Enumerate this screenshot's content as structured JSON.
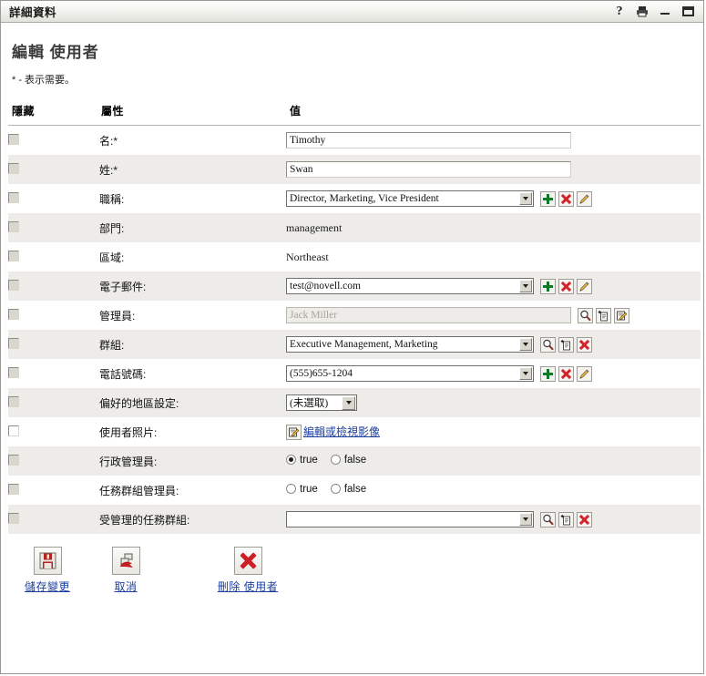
{
  "window": {
    "title": "詳細資料",
    "buttons": {
      "help": "?",
      "print": "print-icon",
      "minimize": "_",
      "maximize": "□"
    }
  },
  "page": {
    "heading": "編輯 使用者",
    "required_note": "* - 表示需要。"
  },
  "table": {
    "headers": {
      "hide": "隱藏",
      "attribute": "屬性",
      "value": "值"
    },
    "rows": [
      {
        "attribute": "名:*",
        "type": "text",
        "value": "Timothy",
        "checkbox_enabled": false,
        "actions": []
      },
      {
        "attribute": "姓:*",
        "type": "text",
        "value": "Swan",
        "checkbox_enabled": false,
        "actions": []
      },
      {
        "attribute": "職稱:",
        "type": "combo",
        "value": "Director, Marketing, Vice President",
        "checkbox_enabled": false,
        "actions": [
          "add-icon",
          "delete-icon",
          "edit-icon"
        ]
      },
      {
        "attribute": "部門:",
        "type": "static",
        "value": "management",
        "checkbox_enabled": false,
        "actions": []
      },
      {
        "attribute": "區域:",
        "type": "static",
        "value": "Northeast",
        "checkbox_enabled": false,
        "actions": []
      },
      {
        "attribute": "電子郵件:",
        "type": "combo",
        "value": "test@novell.com",
        "checkbox_enabled": false,
        "actions": [
          "add-icon",
          "delete-icon",
          "edit-icon"
        ]
      },
      {
        "attribute": "管理員:",
        "type": "text-disabled",
        "value": "Jack Miller",
        "checkbox_enabled": false,
        "actions": [
          "search-icon",
          "object-selector-icon",
          "edit-object-icon"
        ]
      },
      {
        "attribute": "群組:",
        "type": "combo",
        "value": "Executive Management, Marketing",
        "checkbox_enabled": false,
        "actions": [
          "search-icon",
          "object-selector-icon",
          "delete-icon"
        ]
      },
      {
        "attribute": "電話號碼:",
        "type": "combo",
        "value": "(555)655-1204",
        "checkbox_enabled": false,
        "actions": [
          "add-icon",
          "delete-icon",
          "edit-icon"
        ]
      },
      {
        "attribute": "偏好的地區設定:",
        "type": "select",
        "value": "(未選取)",
        "checkbox_enabled": false,
        "actions": []
      },
      {
        "attribute": "使用者照片:",
        "type": "link",
        "value": "編輯或檢視影像",
        "checkbox_enabled": true,
        "actions": [
          "edit-image-icon"
        ]
      },
      {
        "attribute": "行政管理員:",
        "type": "radio",
        "value": "true",
        "options": [
          "true",
          "false"
        ],
        "checkbox_enabled": false,
        "actions": []
      },
      {
        "attribute": "任務群組管理員:",
        "type": "radio",
        "value": "",
        "options": [
          "true",
          "false"
        ],
        "checkbox_enabled": false,
        "actions": []
      },
      {
        "attribute": "受管理的任務群組:",
        "type": "combo",
        "value": "",
        "checkbox_enabled": false,
        "actions": [
          "search-icon",
          "object-selector-icon",
          "delete-icon"
        ]
      }
    ]
  },
  "footer": {
    "save": "儲存變更",
    "cancel": "取消",
    "delete": "刪除 使用者"
  },
  "colors": {
    "link": "#1b3f9e",
    "row_stripe": "#edece8",
    "delete_red": "#cc1f26",
    "add_green": "#0a7a28"
  }
}
